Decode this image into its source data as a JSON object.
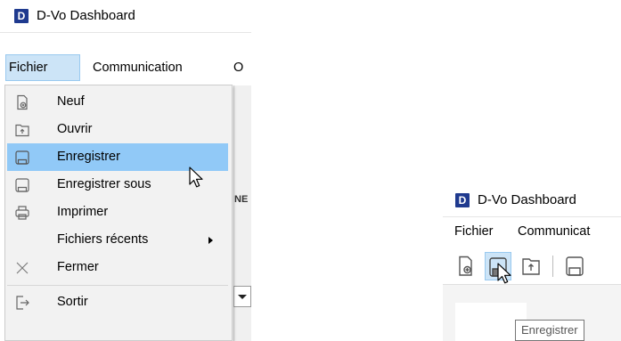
{
  "left_screenshot": {
    "window": {
      "logo_letter": "D",
      "title": "D-Vo Dashboard"
    },
    "menubar": [
      "Fichier",
      "Communication",
      "O"
    ],
    "underlay_text": "NE",
    "fichier_menu": {
      "items": [
        {
          "label": "Neuf",
          "icon": "new-file-icon"
        },
        {
          "label": "Ouvrir",
          "icon": "open-folder-icon"
        },
        {
          "label": "Enregistrer",
          "icon": "save-icon",
          "highlighted": true
        },
        {
          "label": "Enregistrer sous",
          "icon": "save-as-icon"
        },
        {
          "label": "Imprimer",
          "icon": "printer-icon"
        },
        {
          "label": "Fichiers récents",
          "icon": "",
          "submenu": true
        },
        {
          "label": "Fermer",
          "icon": "close-icon"
        },
        {
          "label": "Sortir",
          "icon": "exit-icon"
        }
      ]
    }
  },
  "right_screenshot": {
    "window": {
      "logo_letter": "D",
      "title": "D-Vo Dashboard"
    },
    "menubar": [
      "Fichier",
      "Communicat"
    ],
    "toolbar": [
      "new-file-icon",
      "save-icon",
      "open-folder-icon",
      "save-as-icon"
    ],
    "tooltip": "Enregistrer"
  },
  "colors": {
    "logo_bg": "#1f3a8f",
    "menu_highlight": "#91c9f7",
    "menubar_active": "#cce4f7",
    "dropdown_bg": "#f2f2f2"
  }
}
